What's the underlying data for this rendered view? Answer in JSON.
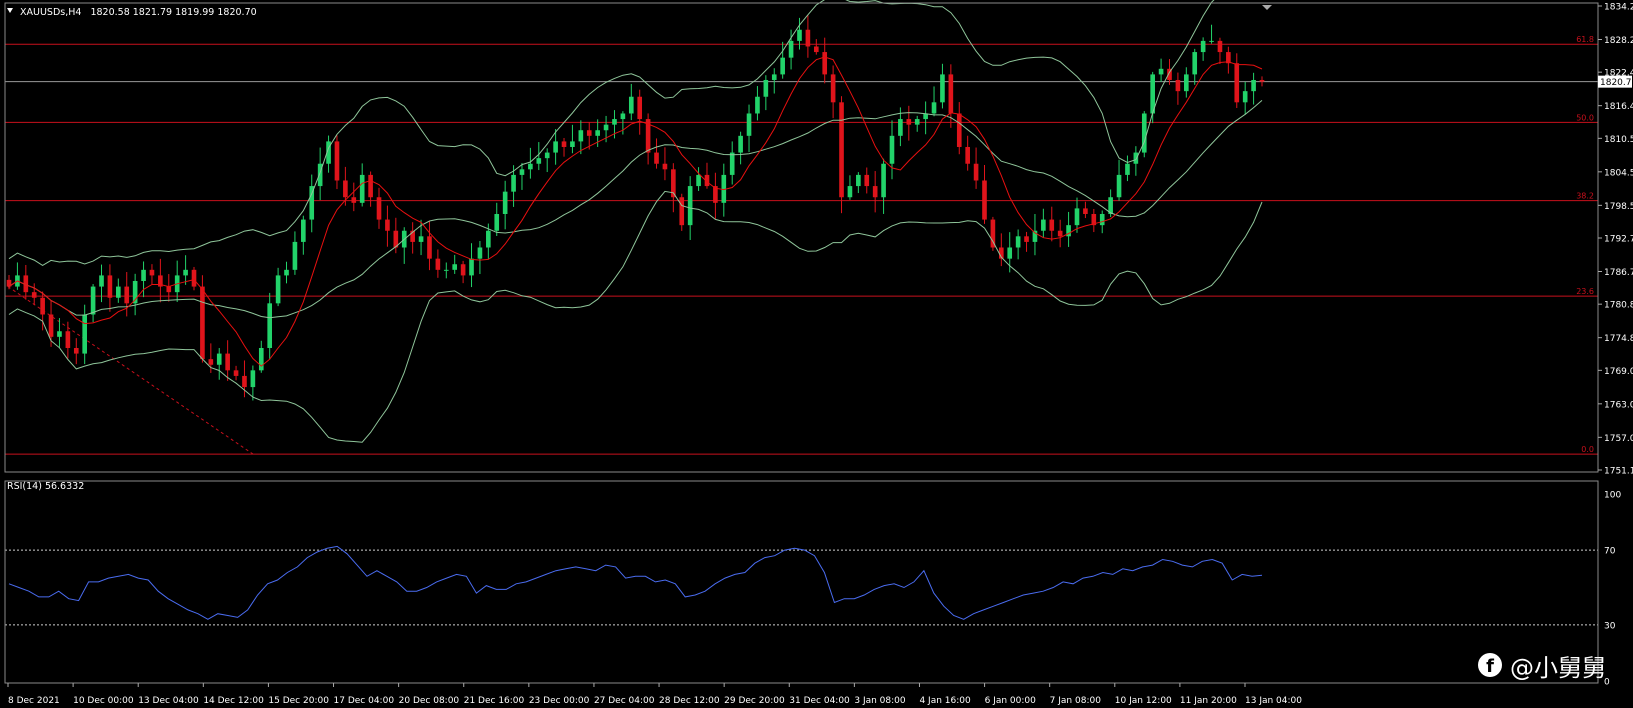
{
  "header": {
    "symbol": "XAUUSDs,H4",
    "ohlc": "1820.58 1821.79 1819.99 1820.70"
  },
  "current_price": "1820.70",
  "price_axis_labels": [
    "1834.25",
    "1828.25",
    "1822.40",
    "1816.40",
    "1810.55",
    "1804.55",
    "1798.55",
    "1792.70",
    "1786.70",
    "1780.85",
    "1774.85",
    "1769.00",
    "1763.00",
    "1757.00",
    "1751.15"
  ],
  "fib_levels": [
    {
      "label": "61.8",
      "price": 1827.4
    },
    {
      "label": "50.0",
      "price": 1813.4
    },
    {
      "label": "38.2",
      "price": 1799.4
    },
    {
      "label": "23.6",
      "price": 1782.3
    },
    {
      "label": "0.0",
      "price": 1754.0
    }
  ],
  "rsi": {
    "label": "RSI(14) 56.6332",
    "axis_labels": [
      "100",
      "70",
      "30",
      "0"
    ],
    "levels": [
      70,
      30
    ]
  },
  "time_axis_labels": [
    "8 Dec 2021",
    "10 Dec 00:00",
    "13 Dec 04:00",
    "14 Dec 12:00",
    "15 Dec 20:00",
    "17 Dec 04:00",
    "20 Dec 08:00",
    "21 Dec 16:00",
    "23 Dec 00:00",
    "27 Dec 04:00",
    "28 Dec 12:00",
    "29 Dec 20:00",
    "31 Dec 04:00",
    "3 Jan 08:00",
    "4 Jan 16:00",
    "6 Jan 00:00",
    "7 Jan 08:00",
    "10 Jan 12:00",
    "11 Jan 20:00",
    "13 Jan 04:00"
  ],
  "colors": {
    "background": "#000000",
    "bull_candle": "#22d36a",
    "bear_candle": "#e0141b",
    "fib_line": "#c8101c",
    "ma_line": "#e81010",
    "bollinger": "#8fc59a",
    "rsi_line": "#4a6cf0",
    "grid_text": "#ffffff"
  },
  "watermark": {
    "icon": "facebook-icon",
    "text": "@小舅舅"
  },
  "chart_data": {
    "type": "candlestick",
    "symbol": "XAUUSDs",
    "timeframe": "H4",
    "ylim": [
      1751.15,
      1834.25
    ],
    "anchor_prices": [
      1833,
      1826,
      1822,
      1820,
      1818,
      1815,
      1812,
      1809,
      1805,
      1803,
      1800,
      1798,
      1795,
      1790,
      1787,
      1783,
      1780,
      1778,
      1775,
      1771,
      1767,
      1765,
      1754
    ],
    "close_path": [
      1784,
      1786,
      1783,
      1782,
      1779,
      1775,
      1776,
      1773,
      1772,
      1779,
      1784,
      1786,
      1782,
      1784,
      1781,
      1785,
      1787,
      1786,
      1784,
      1783,
      1786,
      1787,
      1784,
      1771,
      1770,
      1772,
      1769,
      1768,
      1766,
      1769,
      1773,
      1781,
      1786,
      1787,
      1792,
      1796,
      1802,
      1806,
      1810,
      1803,
      1800,
      1799,
      1804,
      1800,
      1796,
      1794,
      1791,
      1794,
      1792,
      1793,
      1789,
      1787,
      1787,
      1788,
      1786,
      1789,
      1791,
      1794,
      1797,
      1801,
      1804,
      1805,
      1806,
      1807,
      1808,
      1810,
      1809,
      1810,
      1812,
      1811,
      1812,
      1813,
      1814,
      1815,
      1818,
      1814,
      1808,
      1806,
      1805,
      1800,
      1795,
      1802,
      1804,
      1802,
      1799,
      1804,
      1808,
      1811,
      1815,
      1818,
      1821,
      1822,
      1825,
      1828,
      1830,
      1827,
      1826,
      1822,
      1817,
      1800,
      1802,
      1804,
      1802,
      1800,
      1806,
      1811,
      1814,
      1813,
      1814,
      1815,
      1817,
      1822,
      1815,
      1809,
      1806,
      1803,
      1796,
      1791,
      1789,
      1791,
      1793,
      1792,
      1794,
      1796,
      1794,
      1793,
      1795,
      1798,
      1797,
      1795,
      1797,
      1800,
      1804,
      1806,
      1808,
      1815,
      1822,
      1823,
      1821,
      1819,
      1822,
      1826,
      1828,
      1828,
      1826,
      1824,
      1817,
      1819,
      1821,
      1820.7
    ],
    "rsi_values": [
      52,
      50,
      48,
      45,
      45,
      48,
      44,
      43,
      53,
      53,
      55,
      56,
      57,
      55,
      54,
      48,
      44,
      41,
      38,
      36,
      33,
      36,
      35,
      34,
      38,
      46,
      52,
      54,
      58,
      61,
      66,
      69,
      71,
      72,
      68,
      62,
      56,
      59,
      56,
      53,
      48,
      48,
      50,
      53,
      55,
      57,
      56,
      47,
      51,
      49,
      49,
      52,
      53,
      55,
      57,
      59,
      60,
      61,
      60,
      59,
      62,
      61,
      55,
      56,
      56,
      53,
      54,
      52,
      45,
      46,
      48,
      52,
      55,
      57,
      58,
      63,
      66,
      67,
      70,
      71,
      70,
      67,
      58,
      42,
      44,
      44,
      46,
      49,
      51,
      52,
      50,
      53,
      59,
      47,
      40,
      35,
      33,
      36,
      38,
      40,
      42,
      44,
      46,
      47,
      48,
      50,
      53,
      52,
      55,
      56,
      58,
      57,
      60,
      59,
      61,
      62,
      65,
      64,
      62,
      61,
      64,
      65,
      63,
      54,
      57,
      56,
      56.6
    ]
  }
}
